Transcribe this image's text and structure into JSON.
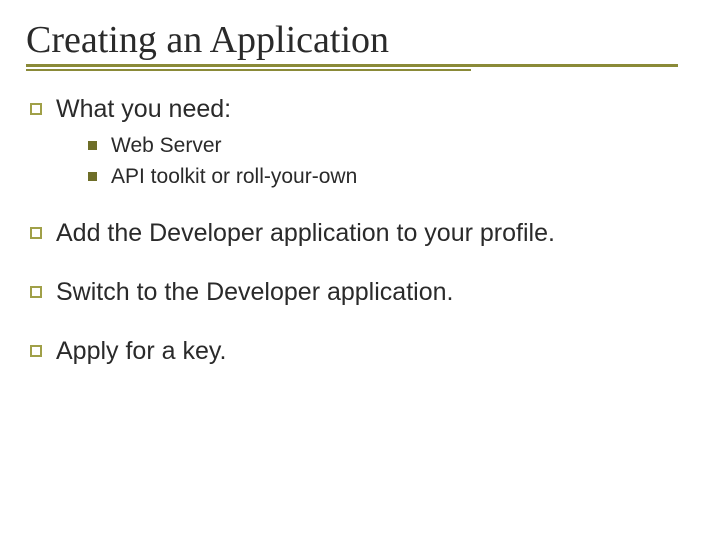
{
  "title": "Creating an Application",
  "bullets": {
    "b1": {
      "text": "What you need:"
    },
    "b1_sub": {
      "s1": "Web Server",
      "s2": "API toolkit or roll-your-own"
    },
    "b2": {
      "text": "Add the Developer application to your profile."
    },
    "b3": {
      "text": "Switch to the Developer application."
    },
    "b4": {
      "text": "Apply for a key."
    }
  },
  "colors": {
    "accent": "#8a8a38",
    "sub_bullet": "#6e6e28"
  }
}
